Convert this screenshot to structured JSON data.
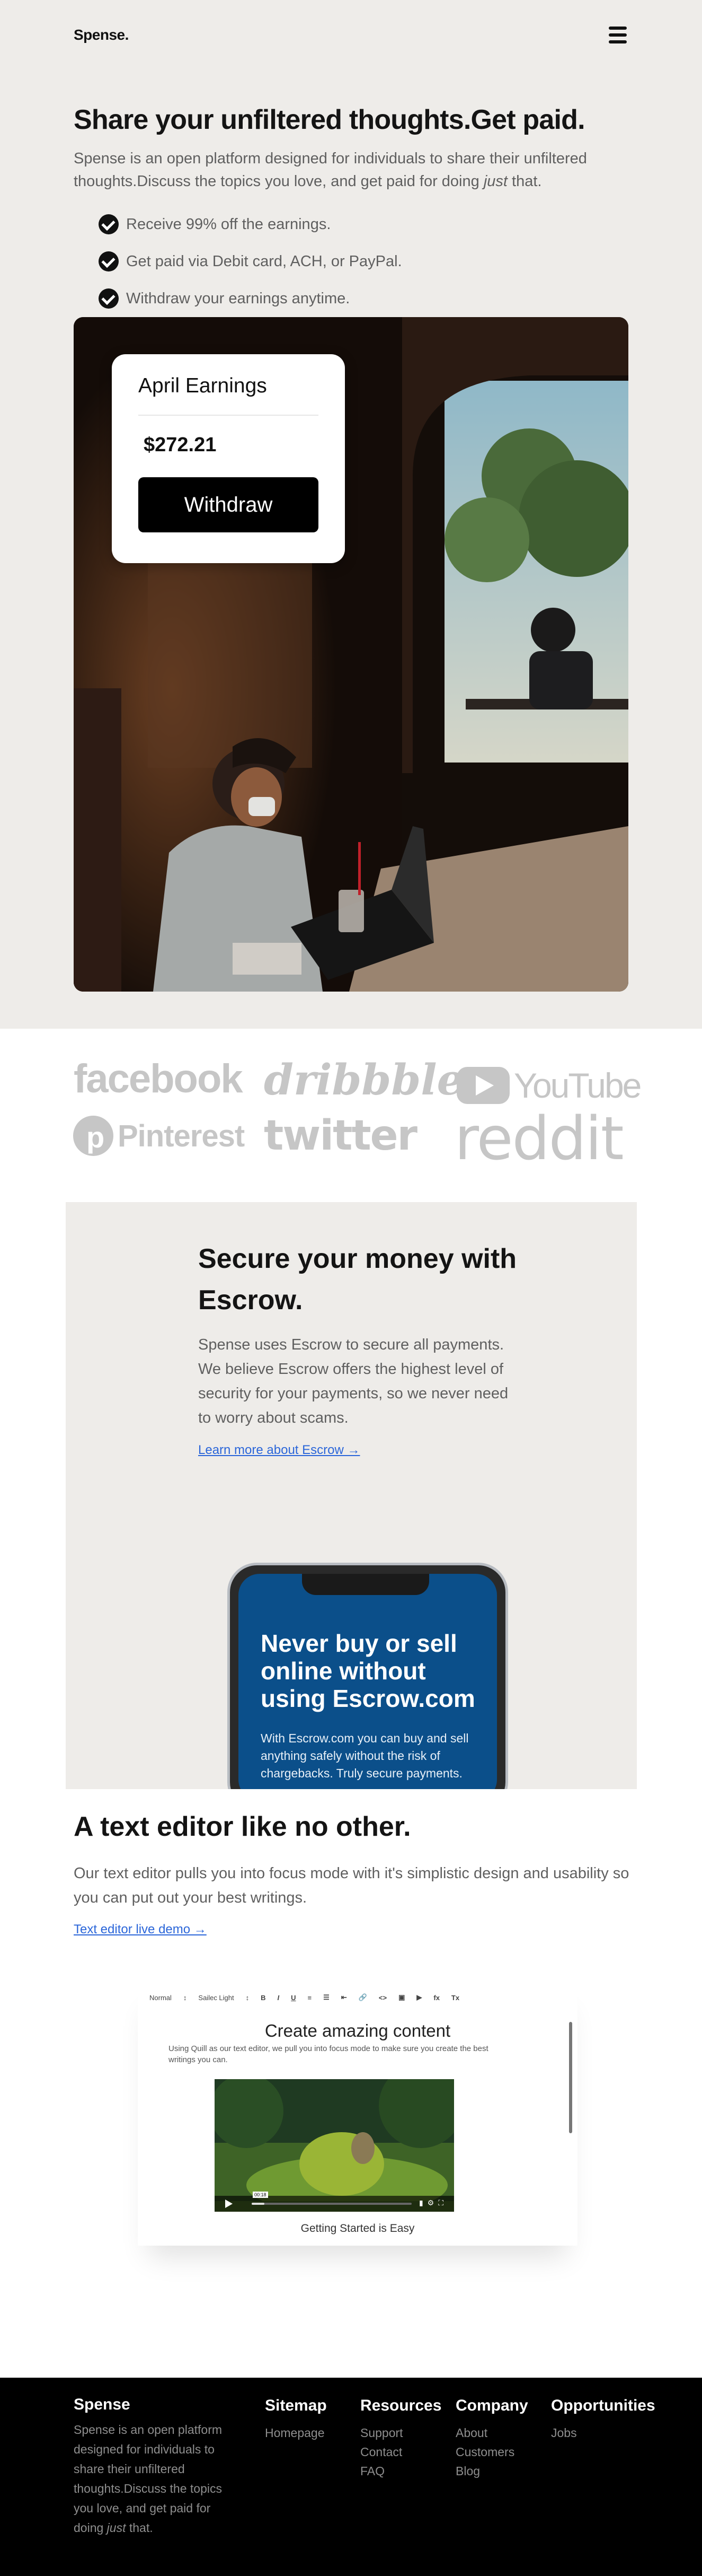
{
  "nav": {
    "brand": "Spense.",
    "menu_icon": "hamburger-menu-icon"
  },
  "hero": {
    "title": "Share your unfiltered thoughts.Get paid.",
    "lead_before": "Spense is an open platform designed for individuals to share their unfiltered thoughts.Discuss the topics you love, and get paid for doing ",
    "lead_em": "just",
    "lead_after": " that.",
    "bullets": [
      "Receive 99% off the earnings.",
      "Get paid via Debit card, ACH, or PayPal.",
      "Withdraw your earnings anytime."
    ]
  },
  "earnings_card": {
    "title": "April Earnings",
    "amount": "$272.21",
    "button": "Withdraw"
  },
  "brands": [
    "facebook",
    "dribbble",
    "YouTube",
    "Pinterest",
    "twitter",
    "reddit"
  ],
  "escrow": {
    "title": "Secure your money with Escrow.",
    "body": "Spense uses Escrow to secure all payments. We believe Escrow offers the highest level of security for your payments, so we never need to worry about scams.",
    "link": "Learn more about Escrow →",
    "phone_title": "Never buy or sell online without using Escrow.com",
    "phone_body": "With Escrow.com you can buy and sell anything safely without the risk of chargebacks. Truly secure payments."
  },
  "editor": {
    "title": "A text editor like no other.",
    "body": "Our text editor pulls you into focus mode with it's simplistic design and usability so you can put out your best writings.",
    "link": "Text editor live demo →",
    "demo": {
      "toolbar": {
        "style": "Normal",
        "font": "Sailec Light",
        "bold": "B",
        "italic": "I",
        "underline": "U",
        "list_ordered": "≡",
        "list_bullet": "☰",
        "align": "⇤",
        "link": "🔗",
        "code": "<>",
        "image": "▣",
        "video": "▶",
        "formula": "fx",
        "clean": "Tx"
      },
      "heading": "Create amazing content",
      "subtext": "Using Quill as our text editor, we pull you into focus mode to make sure you create the best writings you can.",
      "video_time": "00:18",
      "video_progress": 0.08,
      "caption": "Getting Started is Easy"
    }
  },
  "footer": {
    "brand": "Spense",
    "desc_before": "Spense is an open platform designed for individuals to share their unfiltered thoughts.Discuss the topics you love, and get paid for doing ",
    "desc_em": "just",
    "desc_after": " that.",
    "columns": [
      {
        "title": "Sitemap",
        "links": [
          "Homepage"
        ]
      },
      {
        "title": "Resources",
        "links": [
          "Support",
          "Contact",
          "FAQ"
        ]
      },
      {
        "title": "Company",
        "links": [
          "About",
          "Customers",
          "Blog"
        ]
      },
      {
        "title": "Opportunities",
        "links": [
          "Jobs"
        ]
      }
    ]
  }
}
